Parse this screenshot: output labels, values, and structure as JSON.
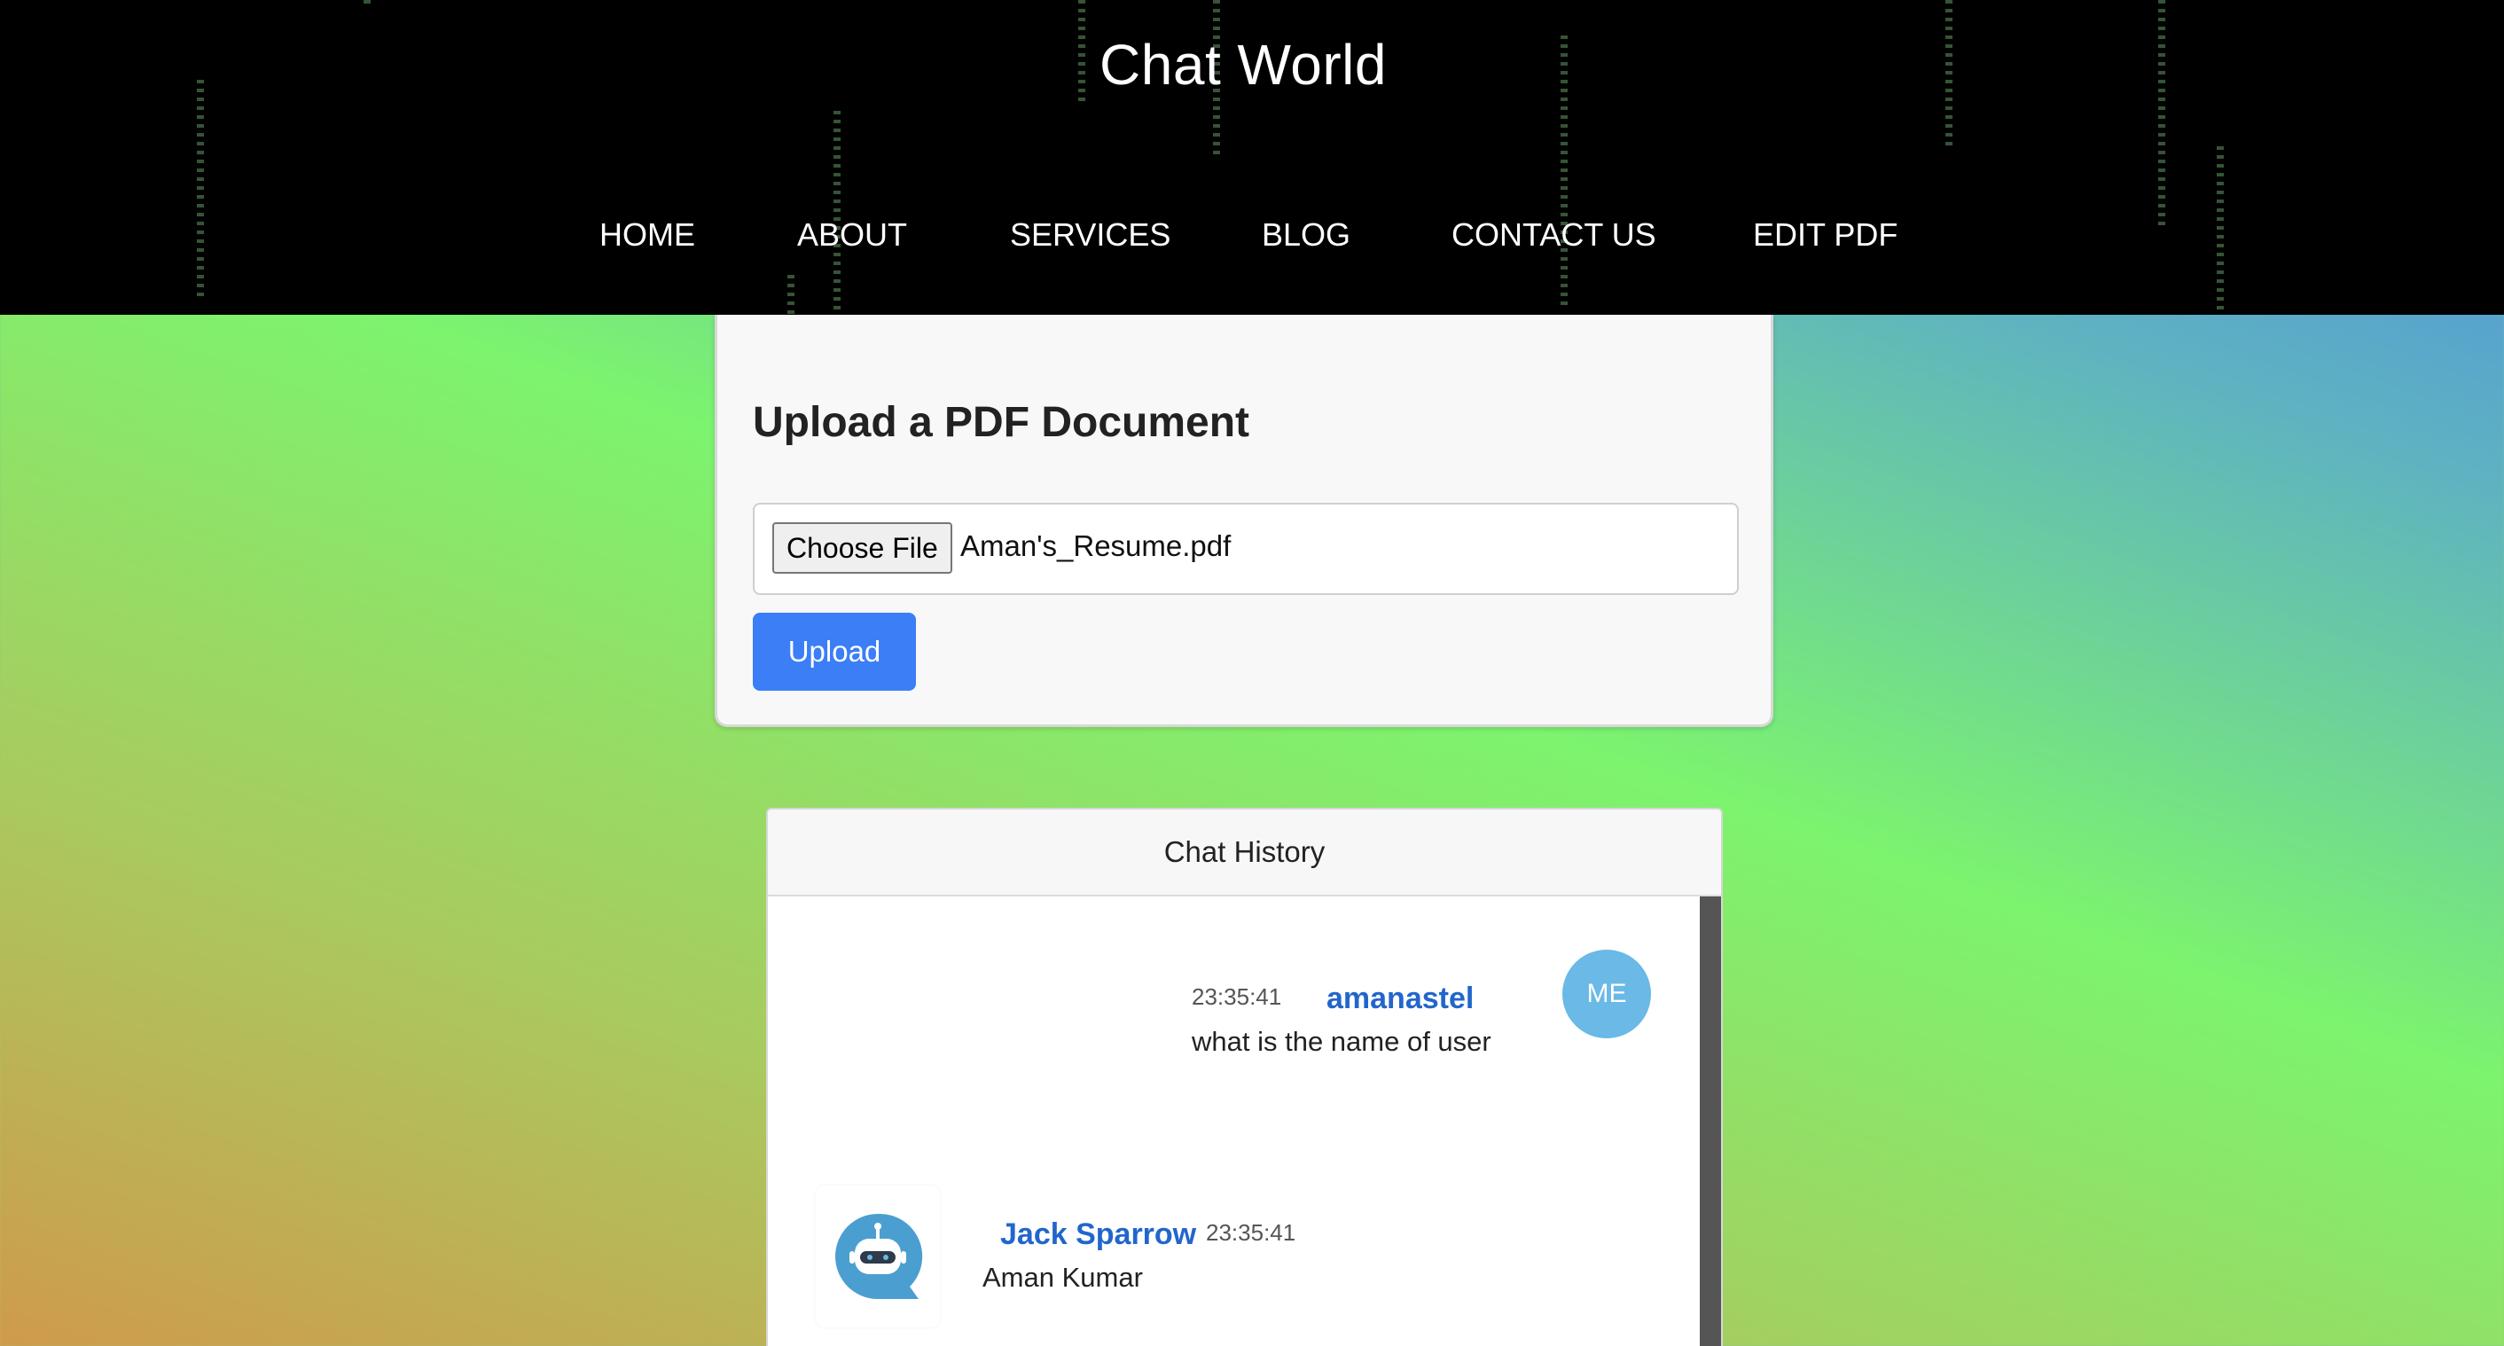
{
  "header": {
    "title": "Chat World"
  },
  "nav": {
    "items": [
      {
        "label": "HOME"
      },
      {
        "label": "ABOUT"
      },
      {
        "label": "SERVICES"
      },
      {
        "label": "BLOG"
      },
      {
        "label": "CONTACT US"
      },
      {
        "label": "EDIT PDF"
      }
    ]
  },
  "upload": {
    "title": "Upload a PDF Document",
    "choose_label": "Choose File",
    "file_name": "Aman's_Resume.pdf",
    "upload_label": "Upload"
  },
  "chat": {
    "title": "Chat History",
    "messages": [
      {
        "time": "23:35:41",
        "user": "amanastel",
        "text": "what is the name of user",
        "avatar": "ME"
      },
      {
        "time": "23:35:41",
        "user": "Jack Sparrow",
        "text": "Aman Kumar",
        "avatar_icon": "robot-chat-icon"
      }
    ]
  },
  "colors": {
    "header_bg": "#000000",
    "primary_button": "#3b7ef6",
    "username": "#2266cc",
    "me_avatar": "#6ab9e6",
    "bot_avatar": "#4a9fd0"
  }
}
